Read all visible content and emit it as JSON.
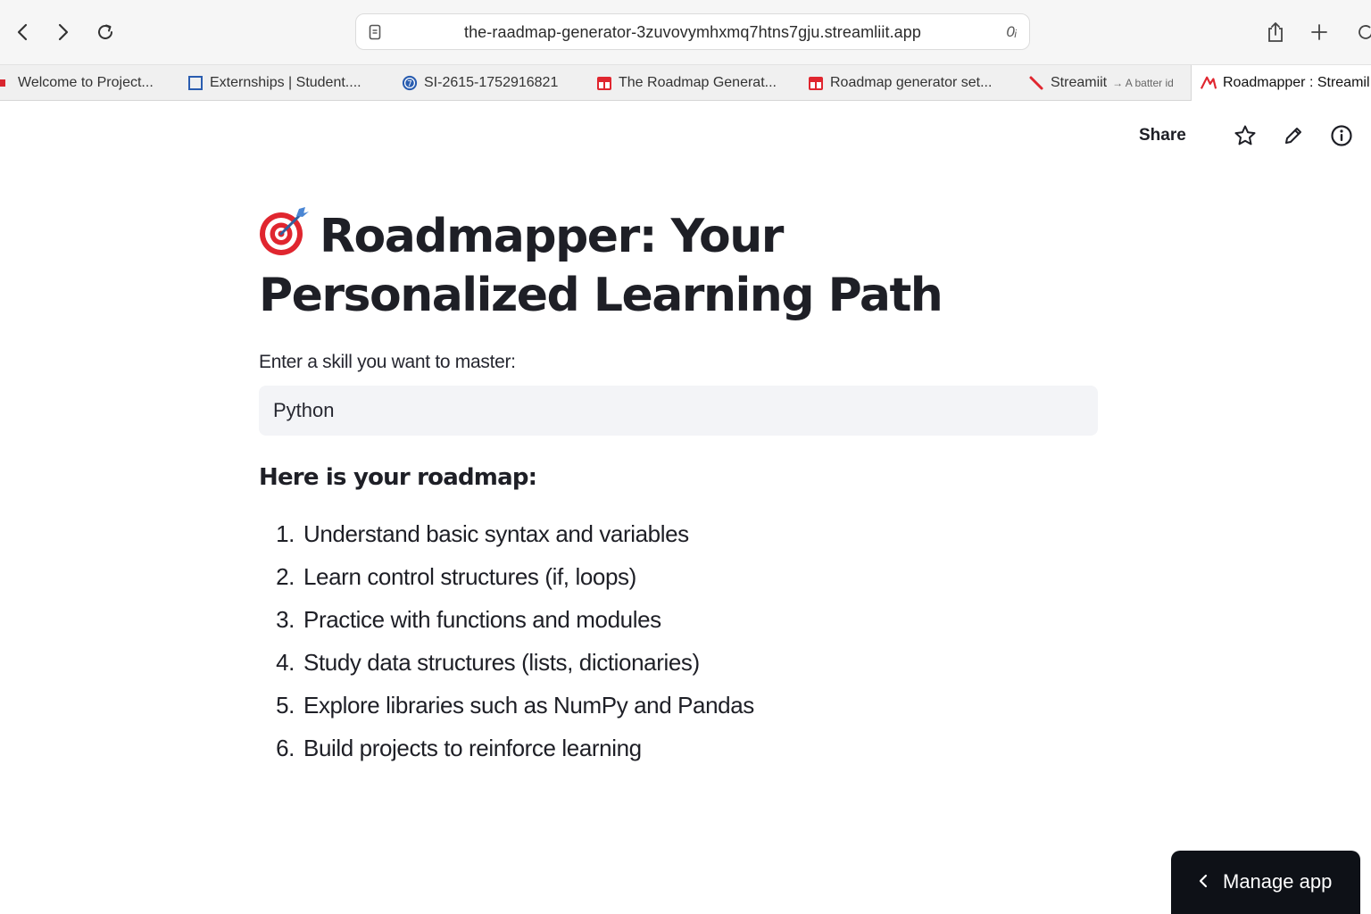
{
  "browser": {
    "url": "the-raadmap-generator-3zuvovymhxmq7htns7gju.streamliit.app",
    "tabs": [
      {
        "label": "Welcome to Project..."
      },
      {
        "label": "Externships | Student...."
      },
      {
        "label": "SI-2615-1752916821"
      },
      {
        "label": "The Roadmap Generat..."
      },
      {
        "label": "Roadmap generator set..."
      },
      {
        "label": "Streamiit",
        "sub": "→ A batter id"
      },
      {
        "label": "Roadmapper : Streamil"
      }
    ]
  },
  "header": {
    "share_label": "Share"
  },
  "main": {
    "title": "Roadmapper: Your Personalized Learning Path",
    "input_label": "Enter a skill you want to master:",
    "input_value": "Python",
    "subheader": "Here is your roadmap:",
    "steps": [
      {
        "num": "1.",
        "text": "Understand basic syntax and variables"
      },
      {
        "num": "2.",
        "text": "Learn control structures (if, loops)"
      },
      {
        "num": "3.",
        "text": "Practice with functions and modules"
      },
      {
        "num": "4.",
        "text": "Study data structures (lists, dictionaries)"
      },
      {
        "num": "5.",
        "text": "Explore libraries such as NumPy and Pandas"
      },
      {
        "num": "6.",
        "text": "Build projects to reinforce learning"
      }
    ]
  },
  "footer": {
    "manage_label": "Manage app"
  },
  "icons": {
    "title_icon": "target-dart-icon",
    "nav": [
      "back-icon",
      "forward-icon",
      "reload-icon"
    ],
    "header": [
      "star-icon",
      "pencil-icon",
      "info-icon"
    ]
  },
  "colors": {
    "text": "#1e1f26",
    "input_bg": "#f3f4f7",
    "manage_bg": "#0e1117",
    "target_red": "#e0262f"
  }
}
